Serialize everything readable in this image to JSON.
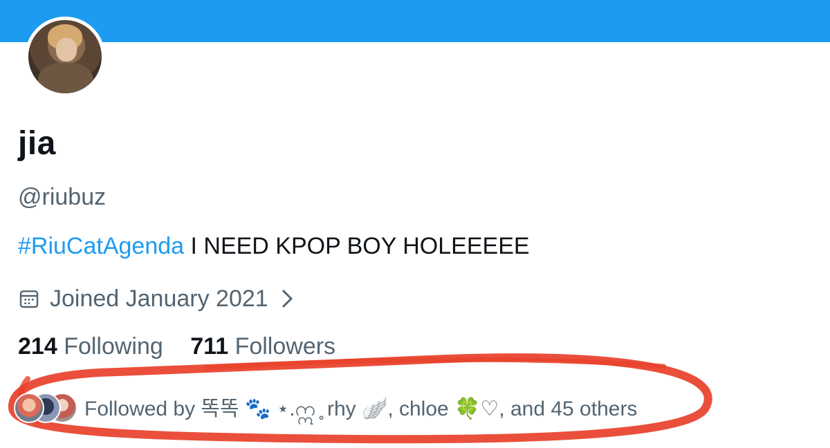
{
  "profile": {
    "banner_color": "#1d9bf0",
    "name": "jia",
    "handle": "@riubuz",
    "bio_hashtag": "#RiuCatAgenda",
    "bio_text": " I NEED KPOP BOY HOLEEEEE",
    "joined": "Joined January 2021",
    "following_count": "214",
    "following_label": "Following",
    "followers_count": "711",
    "followers_label": "Followers",
    "followed_by": "Followed by 똑똑 🐾 ⋆.ဣ ̥ rhy 🪽, chloe 🍀♡, and 45 others"
  },
  "annotation": {
    "color": "#e8402a"
  },
  "icons": {
    "calendar": "calendar-icon",
    "chevron": "chevron-right-icon"
  }
}
